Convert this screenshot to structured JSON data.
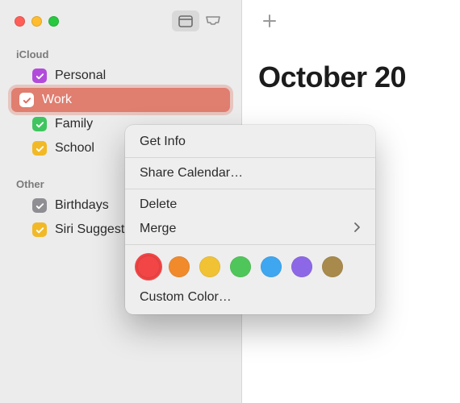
{
  "sidebar": {
    "sections": [
      {
        "title": "iCloud",
        "items": [
          {
            "label": "Personal",
            "color": "#b24bdb"
          },
          {
            "label": "Work",
            "color": "#e2675a",
            "selected": true
          },
          {
            "label": "Family",
            "color": "#3fc55f"
          },
          {
            "label": "School",
            "color": "#f2b927"
          }
        ]
      },
      {
        "title": "Other",
        "items": [
          {
            "label": "Birthdays",
            "color": "#8e8e93"
          },
          {
            "label": "Siri Suggestions",
            "color": "#f2b927"
          }
        ]
      }
    ]
  },
  "main": {
    "title": "October 20"
  },
  "context_menu": {
    "get_info": "Get Info",
    "share": "Share Calendar…",
    "delete": "Delete",
    "merge": "Merge",
    "custom_color": "Custom Color…",
    "colors": [
      {
        "name": "red",
        "hex": "#f24646",
        "selected": true
      },
      {
        "name": "orange",
        "hex": "#f08a2b"
      },
      {
        "name": "yellow",
        "hex": "#f1c233"
      },
      {
        "name": "green",
        "hex": "#4fc659"
      },
      {
        "name": "blue",
        "hex": "#3ea7f0"
      },
      {
        "name": "purple",
        "hex": "#8d68e6"
      },
      {
        "name": "brown",
        "hex": "#a88a4c"
      }
    ]
  }
}
